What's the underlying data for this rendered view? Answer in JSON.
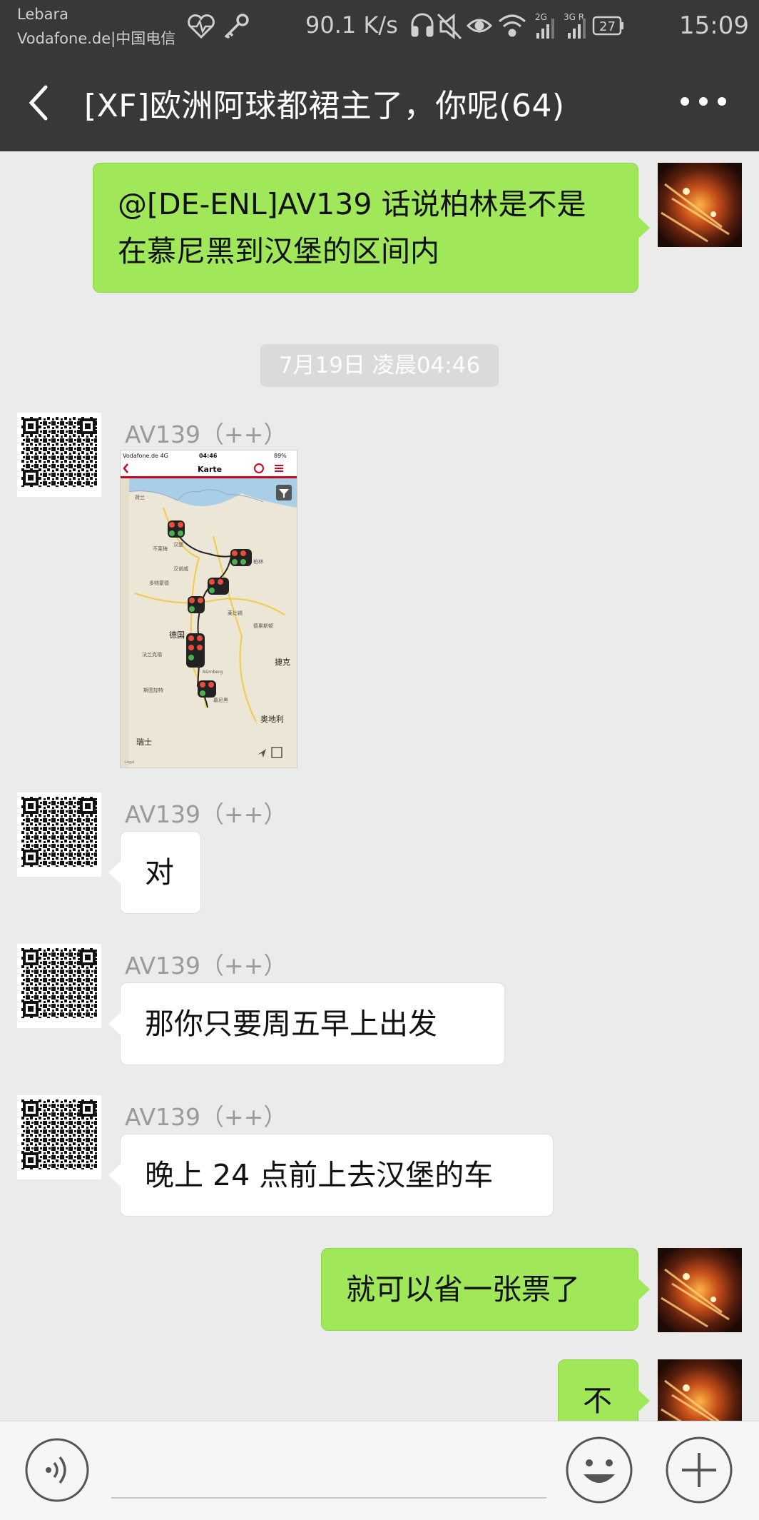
{
  "status_bar": {
    "carrier_line1": "Lebara",
    "carrier_line2": "Vodafone.de|中国电信",
    "net_speed": "90.1 K/s",
    "signal1_label": "2G",
    "signal2_label": "3G R",
    "battery": "27",
    "time": "15:09"
  },
  "nav": {
    "title": "[XF]欧洲阿球都裙主了，你呢(64)"
  },
  "messages": {
    "m1": "@[DE-ENL]AV139  话说柏林是不是",
    "m1b": "在慕尼黑到汉堡的区间内",
    "timestamp": "7月19日 凌晨04:46",
    "sender": "AV139（++）",
    "m3": "对",
    "m4": "那你只要周五早上出发",
    "m5": "晚上 24 点前上去汉堡的车",
    "m6": "就可以省一张票了",
    "m7": "不"
  },
  "map_screenshot": {
    "carrier": "Vodafone.de  4G",
    "time": "04:46",
    "battery": "89%",
    "title": "Karte",
    "labels": {
      "germany": "德国",
      "czech": "捷克",
      "austria": "奥地利",
      "switzerland": "瑞士",
      "nuremberg": "Nürnberg",
      "hamburg": "汉堡",
      "netherlands": "荷兰",
      "berlin": "柏林",
      "bremen": "不莱梅",
      "hanover": "汉诺威",
      "leipzig": "莱比锡",
      "frankfurt": "法兰克福",
      "stuttgart": "斯图加特",
      "munich": "慕尼黑",
      "dortmund": "多特蒙德",
      "dresden": "德累斯顿",
      "legal": "Legal"
    }
  },
  "colors": {
    "outgoing_bubble": "#a0e75a",
    "incoming_bubble": "#ffffff",
    "header_bg": "#383838",
    "background": "#ebebeb"
  }
}
